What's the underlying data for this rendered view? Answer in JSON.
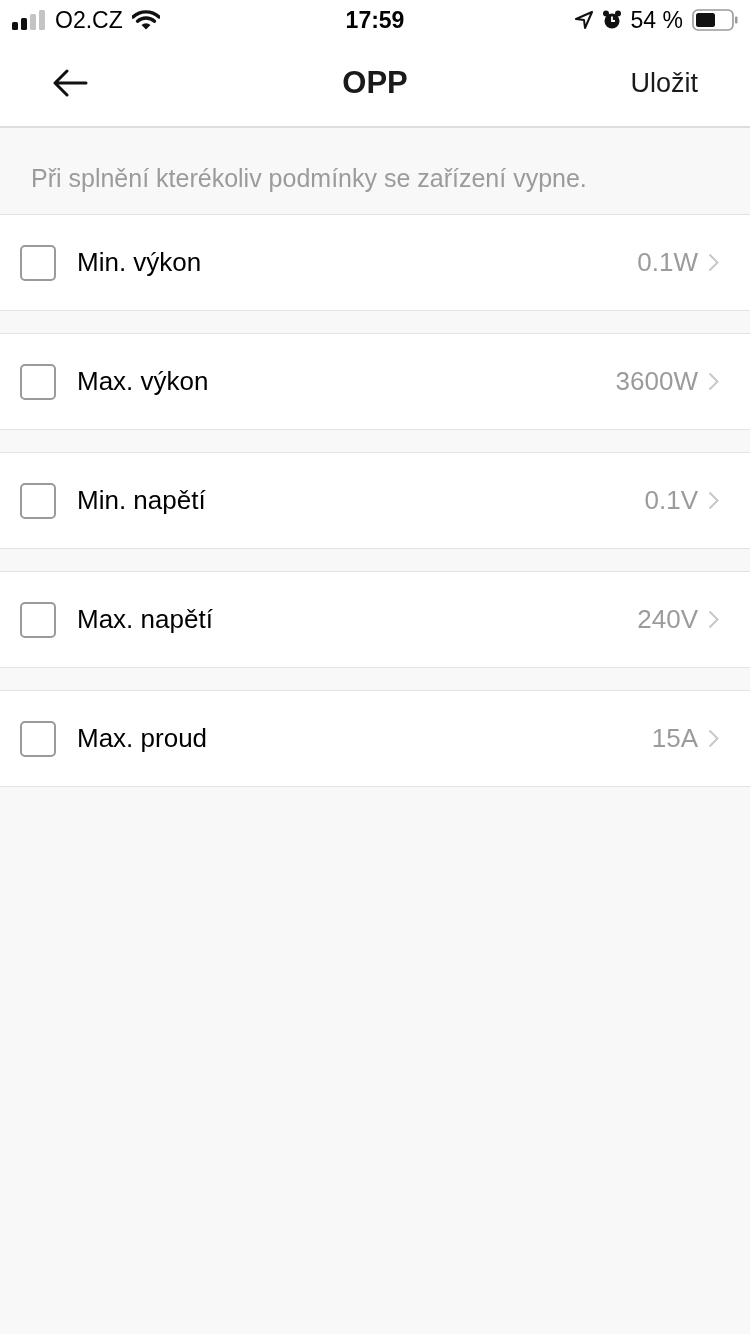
{
  "status_bar": {
    "carrier": "O2.CZ",
    "time": "17:59",
    "battery_text": "54 %"
  },
  "nav_bar": {
    "title": "OPP",
    "action": "Uložit"
  },
  "hint": "Při splnění kterékoliv podmínky se zařízení vypne.",
  "conditions": [
    {
      "label": "Min. výkon",
      "value": "0.1W",
      "checked": false
    },
    {
      "label": "Max. výkon",
      "value": "3600W",
      "checked": false
    },
    {
      "label": "Min. napětí",
      "value": "0.1V",
      "checked": false
    },
    {
      "label": "Max. napětí",
      "value": "240V",
      "checked": false
    },
    {
      "label": "Max. proud",
      "value": "15A",
      "checked": false
    }
  ]
}
